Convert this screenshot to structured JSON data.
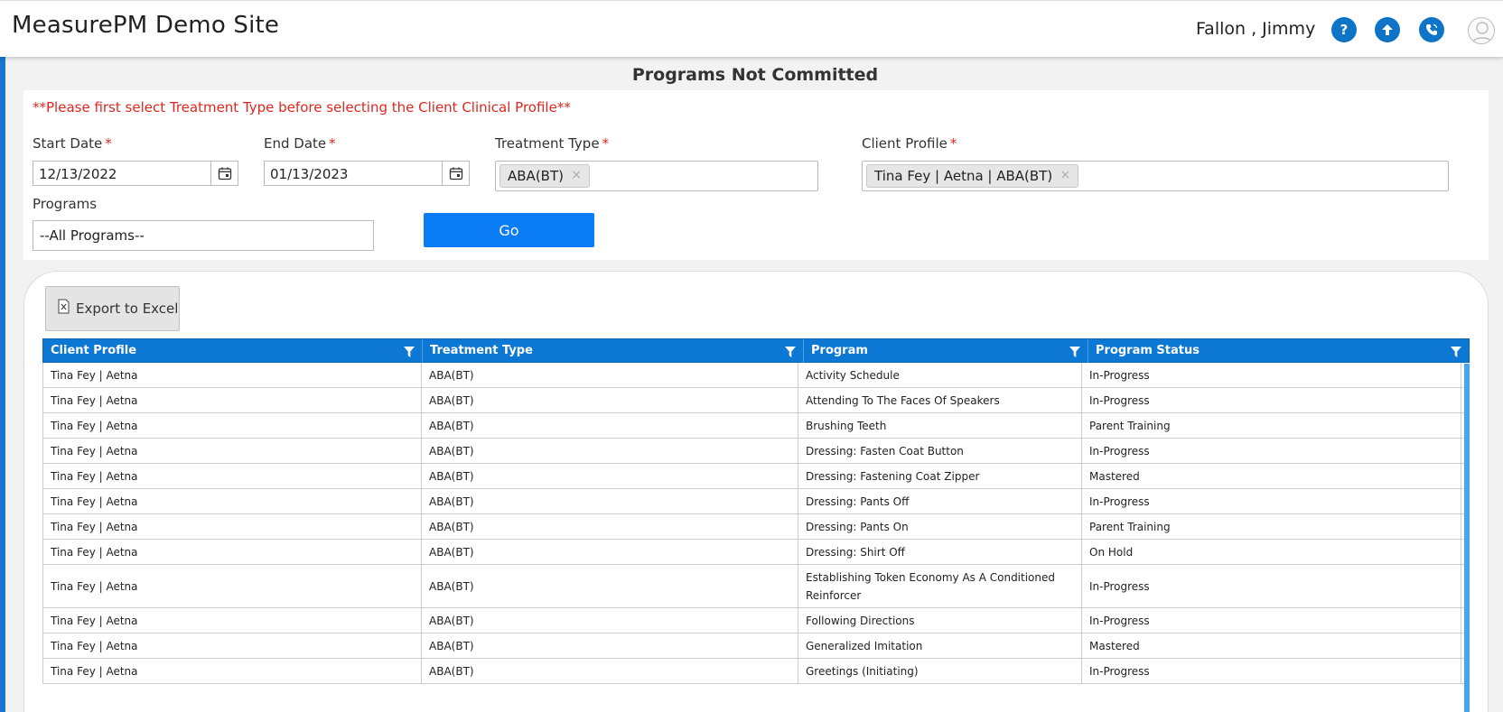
{
  "header": {
    "title": "MeasurePM Demo Site",
    "user_name": "Fallon , Jimmy",
    "icons": [
      "help-icon",
      "upload-icon",
      "phone-icon",
      "user-avatar-icon"
    ],
    "help_glyph": "?"
  },
  "page": {
    "heading": "Programs Not Committed",
    "warning": "**Please first select Treatment Type before selecting the Client Clinical Profile**"
  },
  "filters": {
    "start_date": {
      "label": "Start Date",
      "required": "*",
      "value": "12/13/2022"
    },
    "end_date": {
      "label": "End Date",
      "required": "*",
      "value": "01/13/2023"
    },
    "treatment_type": {
      "label": "Treatment Type",
      "required": "*",
      "tag": "ABA(BT)",
      "remove": "×"
    },
    "client_profile": {
      "label": "Client Profile",
      "required": "*",
      "tag": "Tina Fey | Aetna | ABA(BT)",
      "remove": "×"
    },
    "programs": {
      "label": "Programs",
      "value": "--All Programs--"
    },
    "go_label": "Go"
  },
  "toolbar": {
    "export_label": "Export to Excel"
  },
  "colors": {
    "accent": "#0d78d4",
    "go_button": "#0a7cf5",
    "required": "#e0271f"
  },
  "table": {
    "columns": [
      "Client Profile",
      "Treatment Type",
      "Program",
      "Program Status"
    ],
    "rows": [
      [
        "Tina Fey | Aetna",
        "ABA(BT)",
        "Activity Schedule",
        "In-Progress"
      ],
      [
        "Tina Fey | Aetna",
        "ABA(BT)",
        "Attending To The Faces Of Speakers",
        "In-Progress"
      ],
      [
        "Tina Fey | Aetna",
        "ABA(BT)",
        "Brushing Teeth",
        "Parent Training"
      ],
      [
        "Tina Fey | Aetna",
        "ABA(BT)",
        "Dressing: Fasten Coat Button",
        "In-Progress"
      ],
      [
        "Tina Fey | Aetna",
        "ABA(BT)",
        "Dressing: Fastening Coat Zipper",
        "Mastered"
      ],
      [
        "Tina Fey | Aetna",
        "ABA(BT)",
        "Dressing: Pants Off",
        "In-Progress"
      ],
      [
        "Tina Fey | Aetna",
        "ABA(BT)",
        "Dressing: Pants On",
        "Parent Training"
      ],
      [
        "Tina Fey | Aetna",
        "ABA(BT)",
        "Dressing: Shirt Off",
        "On Hold"
      ],
      [
        "Tina Fey | Aetna",
        "ABA(BT)",
        "Establishing Token Economy As A Conditioned Reinforcer",
        "In-Progress"
      ],
      [
        "Tina Fey | Aetna",
        "ABA(BT)",
        "Following Directions",
        "In-Progress"
      ],
      [
        "Tina Fey | Aetna",
        "ABA(BT)",
        "Generalized Imitation",
        "Mastered"
      ],
      [
        "Tina Fey | Aetna",
        "ABA(BT)",
        "Greetings (Initiating)",
        "In-Progress"
      ]
    ]
  }
}
